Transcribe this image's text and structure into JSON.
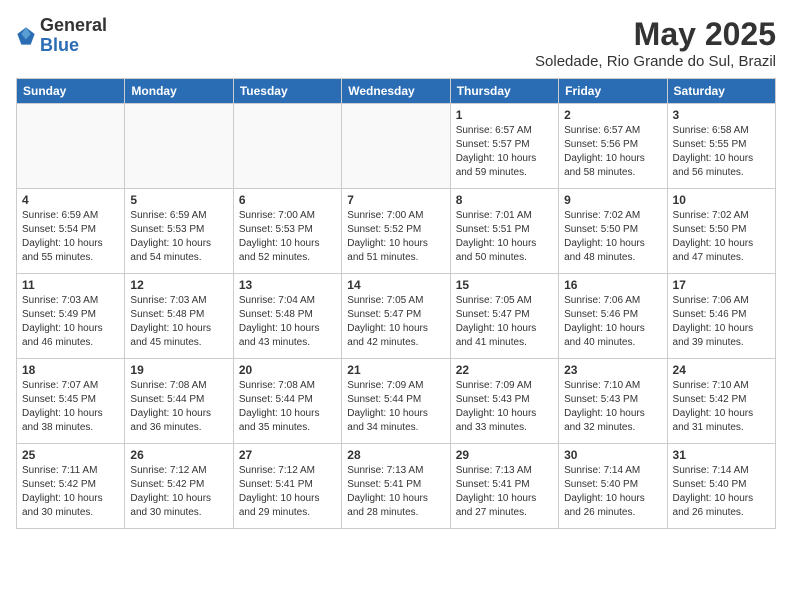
{
  "header": {
    "logo": {
      "general": "General",
      "blue": "Blue"
    },
    "title": "May 2025",
    "subtitle": "Soledade, Rio Grande do Sul, Brazil"
  },
  "days_of_week": [
    "Sunday",
    "Monday",
    "Tuesday",
    "Wednesday",
    "Thursday",
    "Friday",
    "Saturday"
  ],
  "weeks": [
    [
      {
        "day": "",
        "info": ""
      },
      {
        "day": "",
        "info": ""
      },
      {
        "day": "",
        "info": ""
      },
      {
        "day": "",
        "info": ""
      },
      {
        "day": "1",
        "info": "Sunrise: 6:57 AM\nSunset: 5:57 PM\nDaylight: 10 hours\nand 59 minutes."
      },
      {
        "day": "2",
        "info": "Sunrise: 6:57 AM\nSunset: 5:56 PM\nDaylight: 10 hours\nand 58 minutes."
      },
      {
        "day": "3",
        "info": "Sunrise: 6:58 AM\nSunset: 5:55 PM\nDaylight: 10 hours\nand 56 minutes."
      }
    ],
    [
      {
        "day": "4",
        "info": "Sunrise: 6:59 AM\nSunset: 5:54 PM\nDaylight: 10 hours\nand 55 minutes."
      },
      {
        "day": "5",
        "info": "Sunrise: 6:59 AM\nSunset: 5:53 PM\nDaylight: 10 hours\nand 54 minutes."
      },
      {
        "day": "6",
        "info": "Sunrise: 7:00 AM\nSunset: 5:53 PM\nDaylight: 10 hours\nand 52 minutes."
      },
      {
        "day": "7",
        "info": "Sunrise: 7:00 AM\nSunset: 5:52 PM\nDaylight: 10 hours\nand 51 minutes."
      },
      {
        "day": "8",
        "info": "Sunrise: 7:01 AM\nSunset: 5:51 PM\nDaylight: 10 hours\nand 50 minutes."
      },
      {
        "day": "9",
        "info": "Sunrise: 7:02 AM\nSunset: 5:50 PM\nDaylight: 10 hours\nand 48 minutes."
      },
      {
        "day": "10",
        "info": "Sunrise: 7:02 AM\nSunset: 5:50 PM\nDaylight: 10 hours\nand 47 minutes."
      }
    ],
    [
      {
        "day": "11",
        "info": "Sunrise: 7:03 AM\nSunset: 5:49 PM\nDaylight: 10 hours\nand 46 minutes."
      },
      {
        "day": "12",
        "info": "Sunrise: 7:03 AM\nSunset: 5:48 PM\nDaylight: 10 hours\nand 45 minutes."
      },
      {
        "day": "13",
        "info": "Sunrise: 7:04 AM\nSunset: 5:48 PM\nDaylight: 10 hours\nand 43 minutes."
      },
      {
        "day": "14",
        "info": "Sunrise: 7:05 AM\nSunset: 5:47 PM\nDaylight: 10 hours\nand 42 minutes."
      },
      {
        "day": "15",
        "info": "Sunrise: 7:05 AM\nSunset: 5:47 PM\nDaylight: 10 hours\nand 41 minutes."
      },
      {
        "day": "16",
        "info": "Sunrise: 7:06 AM\nSunset: 5:46 PM\nDaylight: 10 hours\nand 40 minutes."
      },
      {
        "day": "17",
        "info": "Sunrise: 7:06 AM\nSunset: 5:46 PM\nDaylight: 10 hours\nand 39 minutes."
      }
    ],
    [
      {
        "day": "18",
        "info": "Sunrise: 7:07 AM\nSunset: 5:45 PM\nDaylight: 10 hours\nand 38 minutes."
      },
      {
        "day": "19",
        "info": "Sunrise: 7:08 AM\nSunset: 5:44 PM\nDaylight: 10 hours\nand 36 minutes."
      },
      {
        "day": "20",
        "info": "Sunrise: 7:08 AM\nSunset: 5:44 PM\nDaylight: 10 hours\nand 35 minutes."
      },
      {
        "day": "21",
        "info": "Sunrise: 7:09 AM\nSunset: 5:44 PM\nDaylight: 10 hours\nand 34 minutes."
      },
      {
        "day": "22",
        "info": "Sunrise: 7:09 AM\nSunset: 5:43 PM\nDaylight: 10 hours\nand 33 minutes."
      },
      {
        "day": "23",
        "info": "Sunrise: 7:10 AM\nSunset: 5:43 PM\nDaylight: 10 hours\nand 32 minutes."
      },
      {
        "day": "24",
        "info": "Sunrise: 7:10 AM\nSunset: 5:42 PM\nDaylight: 10 hours\nand 31 minutes."
      }
    ],
    [
      {
        "day": "25",
        "info": "Sunrise: 7:11 AM\nSunset: 5:42 PM\nDaylight: 10 hours\nand 30 minutes."
      },
      {
        "day": "26",
        "info": "Sunrise: 7:12 AM\nSunset: 5:42 PM\nDaylight: 10 hours\nand 30 minutes."
      },
      {
        "day": "27",
        "info": "Sunrise: 7:12 AM\nSunset: 5:41 PM\nDaylight: 10 hours\nand 29 minutes."
      },
      {
        "day": "28",
        "info": "Sunrise: 7:13 AM\nSunset: 5:41 PM\nDaylight: 10 hours\nand 28 minutes."
      },
      {
        "day": "29",
        "info": "Sunrise: 7:13 AM\nSunset: 5:41 PM\nDaylight: 10 hours\nand 27 minutes."
      },
      {
        "day": "30",
        "info": "Sunrise: 7:14 AM\nSunset: 5:40 PM\nDaylight: 10 hours\nand 26 minutes."
      },
      {
        "day": "31",
        "info": "Sunrise: 7:14 AM\nSunset: 5:40 PM\nDaylight: 10 hours\nand 26 minutes."
      }
    ]
  ]
}
